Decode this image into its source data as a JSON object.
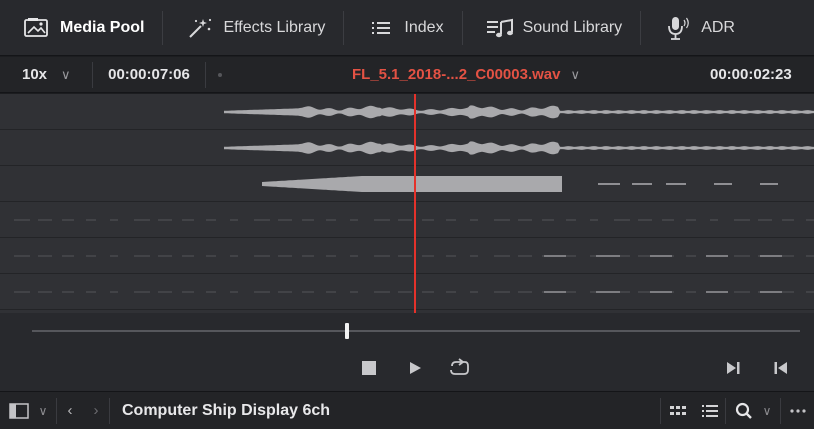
{
  "tabs": [
    {
      "label": "Media Pool",
      "icon": "media-pool-icon",
      "active": true
    },
    {
      "label": "Effects Library",
      "icon": "effects-wand-icon",
      "active": false
    },
    {
      "label": "Index",
      "icon": "index-list-icon",
      "active": false
    },
    {
      "label": "Sound Library",
      "icon": "sound-library-icon",
      "active": false
    },
    {
      "label": "ADR",
      "icon": "microphone-icon",
      "active": false
    }
  ],
  "clip_header": {
    "zoom": "10x",
    "source_timecode": "00:00:07:06",
    "clip_name": "FL_5.1_2018-...2_C00003.wav",
    "playhead_timecode": "00:00:02:23"
  },
  "playback": {
    "position_fraction": 0.41,
    "channel_count": 6
  },
  "transport": {
    "stop_icon": "stop-icon",
    "play_icon": "play-icon",
    "loop_icon": "loop-icon",
    "next_icon": "jump-to-end-icon",
    "prev_icon": "jump-to-start-icon"
  },
  "bottom_bar": {
    "bin_title": "Computer Ship Display 6ch"
  },
  "colors": {
    "accent_red": "#e4322b",
    "clip_name_red": "#e35244",
    "waveform": "#a9a9ac",
    "background": "#303135"
  }
}
